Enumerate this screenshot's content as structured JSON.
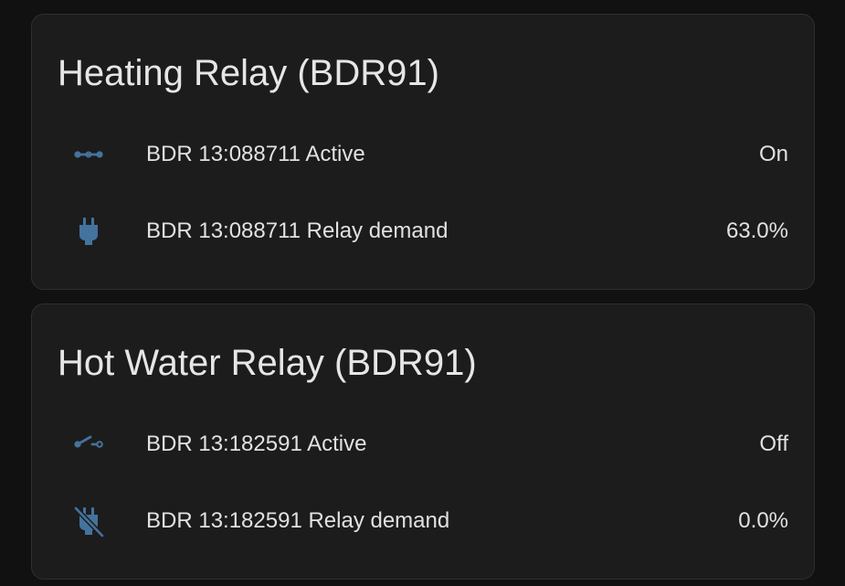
{
  "colors": {
    "background": "#111111",
    "card": "#1c1c1c",
    "icon": "#44739e",
    "text": "#e1e1e1"
  },
  "cards": [
    {
      "title": "Heating Relay (BDR91)",
      "rows": [
        {
          "icon": "switch-closed-icon",
          "name": "BDR 13:088711 Active",
          "state": "On"
        },
        {
          "icon": "power-plug-icon",
          "name": "BDR 13:088711 Relay demand",
          "state": "63.0%"
        }
      ]
    },
    {
      "title": "Hot Water Relay (BDR91)",
      "rows": [
        {
          "icon": "switch-open-icon",
          "name": "BDR 13:182591 Active",
          "state": "Off"
        },
        {
          "icon": "power-plug-off-icon",
          "name": "BDR 13:182591 Relay demand",
          "state": "0.0%"
        }
      ]
    }
  ]
}
